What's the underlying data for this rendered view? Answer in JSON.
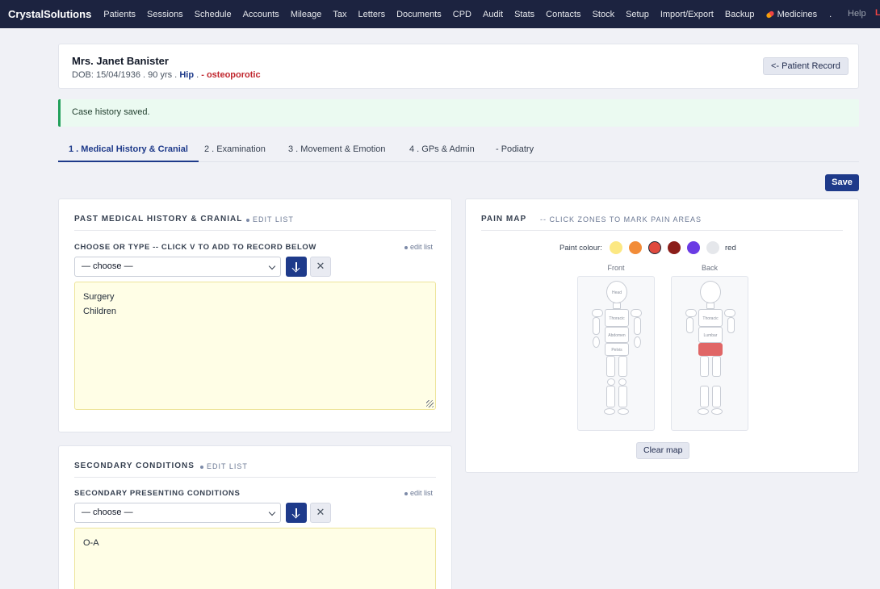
{
  "nav": {
    "brand": "CrystalSolutions",
    "items": [
      "Patients",
      "Sessions",
      "Schedule",
      "Accounts",
      "Mileage",
      "Tax",
      "Letters",
      "Documents",
      "CPD",
      "Audit",
      "Stats",
      "Contacts",
      "Stock",
      "Setup",
      "Import/Export",
      "Backup"
    ],
    "medicines": "Medicines",
    "medicines_icon": "pill-icon",
    "dot": ".",
    "help": "Help",
    "user": "L"
  },
  "patient": {
    "name": "Mrs. Janet Banister",
    "dob_text": "DOB: 15/04/1936 . 90 yrs .",
    "region": "Hip",
    "sep": ".",
    "condition": "- osteoporotic",
    "record_button": "<- Patient Record"
  },
  "alert": {
    "message": "Case history saved."
  },
  "tabs": [
    "1 . Medical History & Cranial",
    "2 . Examination",
    "3 . Movement & Emotion",
    "4 . GPs & Admin",
    "- Podiatry"
  ],
  "save_label": "Save",
  "past_medical": {
    "title": "PAST MEDICAL HISTORY & CRANIAL",
    "edit_list": "EDIT LIST",
    "field_label": "CHOOSE OR TYPE -- CLICK V TO ADD TO RECORD BELOW",
    "edit_link": "edit list",
    "select_value": "— choose —",
    "clear_symbol": "✕",
    "lines": [
      "Surgery",
      "Children"
    ]
  },
  "secondary": {
    "title": "SECONDARY CONDITIONS",
    "edit_list": "EDIT LIST",
    "field_label": "SECONDARY PRESENTING CONDITIONS",
    "edit_link": "edit list",
    "select_value": "— choose —",
    "clear_symbol": "✕",
    "lines": [
      "O-A"
    ]
  },
  "pain_map": {
    "title": "PAIN MAP",
    "subtitle": "-- CLICK ZONES TO MARK PAIN AREAS",
    "paint_label": "Paint colour:",
    "selected_colour_name": "red",
    "colours": [
      "#fce883",
      "#f28c38",
      "#e04a3f",
      "#8b1e1a",
      "#6a3be4",
      "#e5e7eb"
    ],
    "selected_index": 2,
    "front_label": "Front",
    "back_label": "Back",
    "front_zones": [
      "Head",
      "Thoracic",
      "Abdomen",
      "Pelvis"
    ],
    "back_zones": [
      "Thoracic",
      "Lumbar"
    ],
    "clear_button": "Clear map"
  }
}
